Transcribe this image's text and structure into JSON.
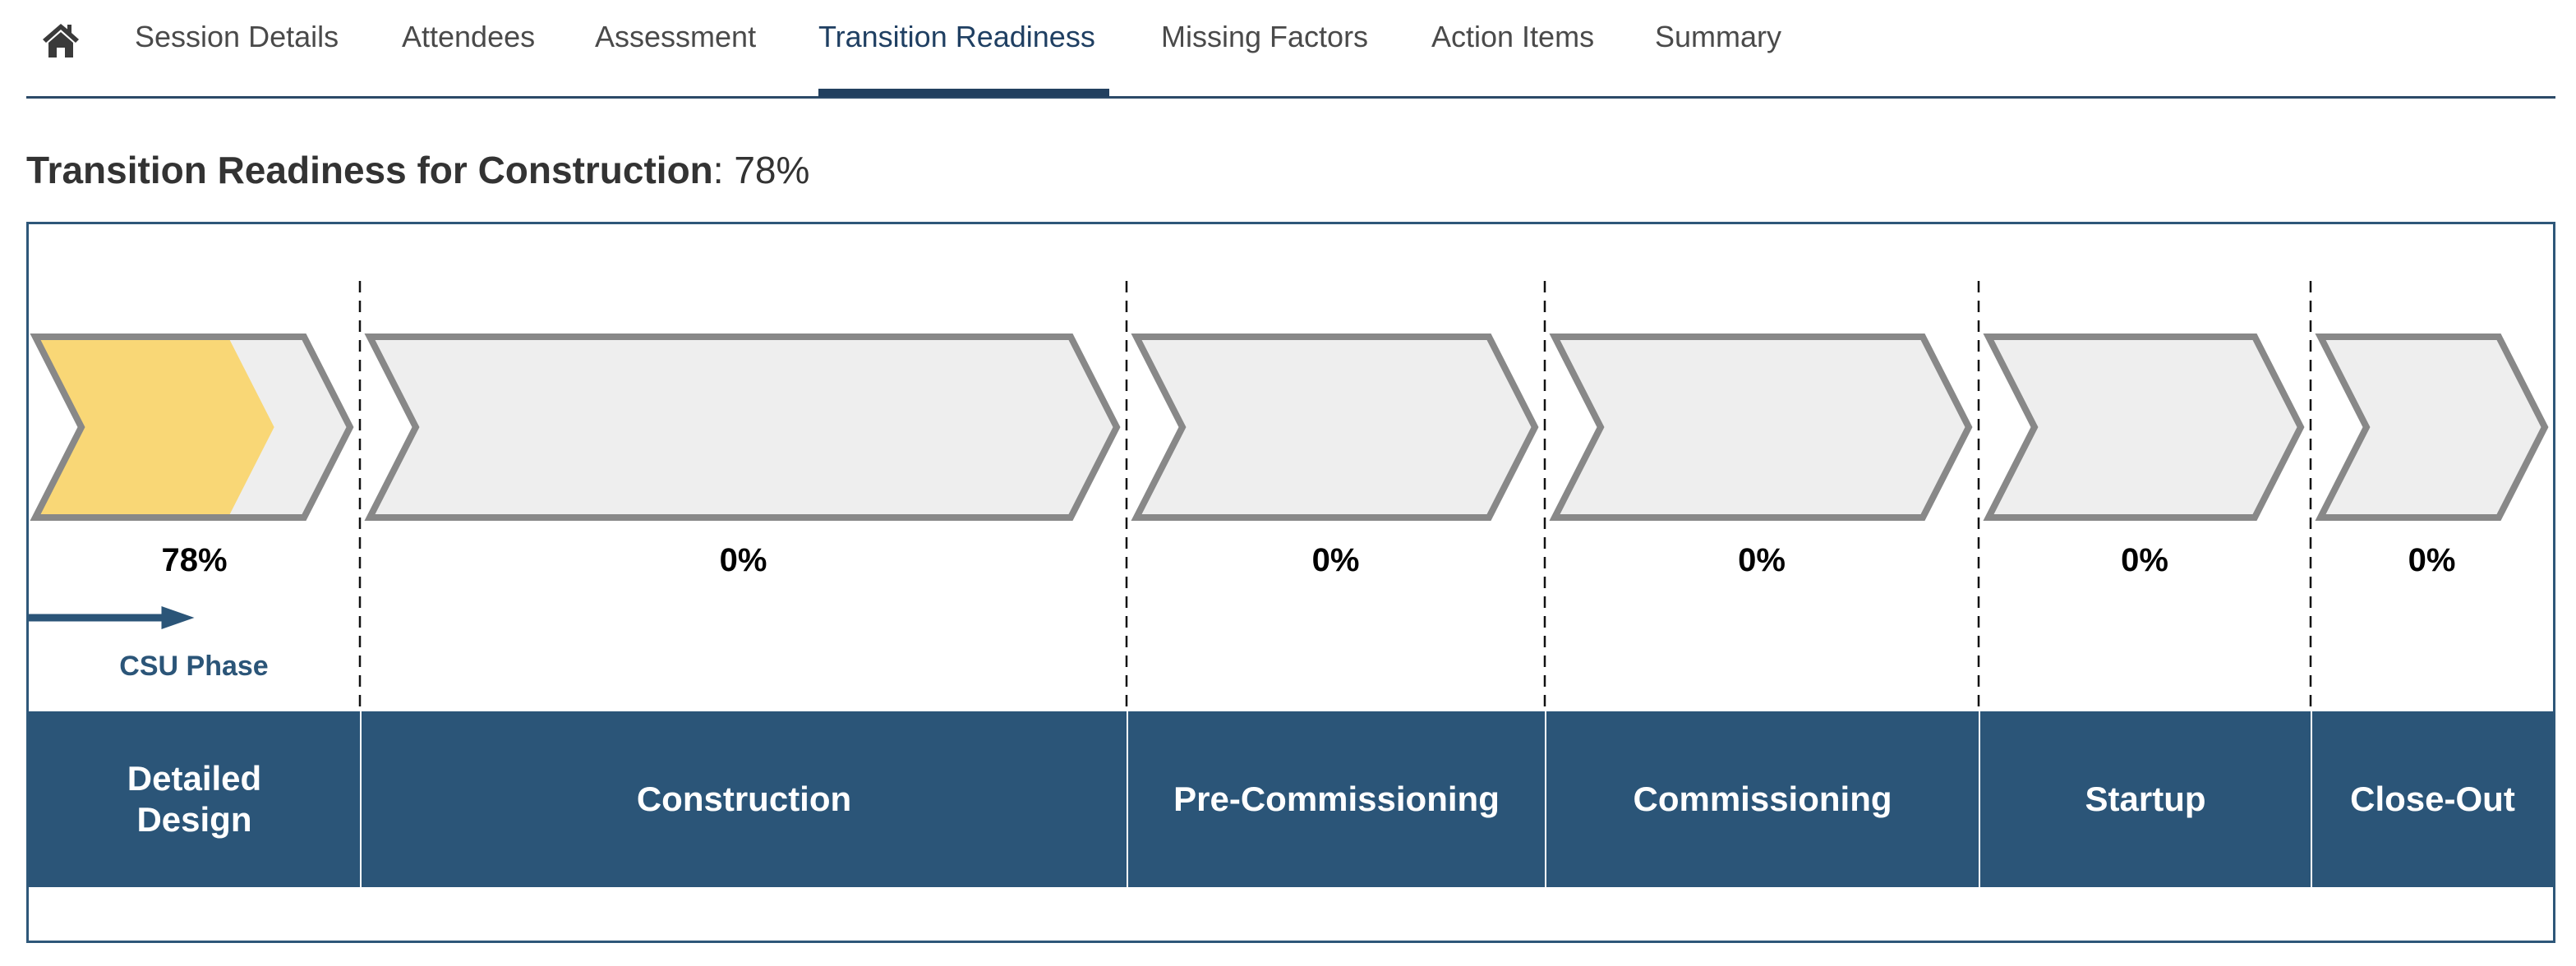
{
  "nav": {
    "home_icon": "home-icon",
    "tabs": [
      {
        "label": "Session Details",
        "active": false
      },
      {
        "label": "Attendees",
        "active": false
      },
      {
        "label": "Assessment",
        "active": false
      },
      {
        "label": "Transition Readiness",
        "active": true
      },
      {
        "label": "Missing Factors",
        "active": false
      },
      {
        "label": "Action Items",
        "active": false
      },
      {
        "label": "Summary",
        "active": false
      }
    ]
  },
  "page": {
    "title_bold": "Transition Readiness for Construction",
    "title_value": ": 78%"
  },
  "readiness": {
    "csu_phase_label": "CSU Phase",
    "csu_phase_index": 0,
    "colors": {
      "progress_fill": "#f9d776",
      "chevron_fill": "#eeeeee",
      "chevron_stroke": "#888888",
      "phase_band": "#2b5578",
      "csu_arrow": "#2b5578"
    },
    "phases": [
      {
        "name": "Detailed Design",
        "name_lines": [
          "Detailed",
          "Design"
        ],
        "percent_label": "78%",
        "percent": 78
      },
      {
        "name": "Construction",
        "name_lines": [
          "Construction"
        ],
        "percent_label": "0%",
        "percent": 0
      },
      {
        "name": "Pre-Commissioning",
        "name_lines": [
          "Pre-Commissioning"
        ],
        "percent_label": "0%",
        "percent": 0
      },
      {
        "name": "Commissioning",
        "name_lines": [
          "Commissioning"
        ],
        "percent_label": "0%",
        "percent": 0
      },
      {
        "name": "Startup",
        "name_lines": [
          "Startup"
        ],
        "percent_label": "0%",
        "percent": 0
      },
      {
        "name": "Close-Out",
        "name_lines": [
          "Close-Out"
        ],
        "percent_label": "0%",
        "percent": 0
      }
    ]
  }
}
